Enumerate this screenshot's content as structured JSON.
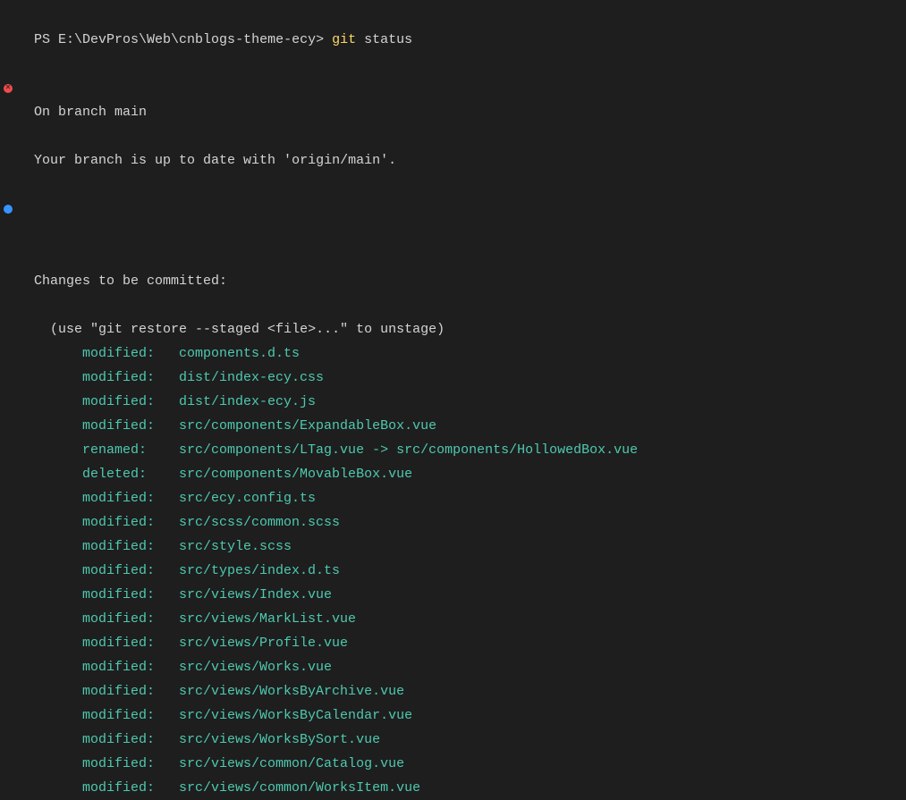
{
  "prompt": {
    "prefix": "PS ",
    "path": "E:\\DevPros\\Web\\cnblogs-theme-ecy",
    "suffix": "> ",
    "command": "git",
    "args": " status"
  },
  "branch_info": {
    "line1": "On branch main",
    "line2": "Your branch is up to date with 'origin/main'."
  },
  "section": {
    "title": "Changes to be committed:",
    "hint": "  (use \"git restore --staged <file>...\" to unstage)"
  },
  "files": [
    {
      "status": "modified:",
      "path": "components.d.ts"
    },
    {
      "status": "modified:",
      "path": "dist/index-ecy.css"
    },
    {
      "status": "modified:",
      "path": "dist/index-ecy.js"
    },
    {
      "status": "modified:",
      "path": "src/components/ExpandableBox.vue"
    },
    {
      "status": "renamed: ",
      "path": "src/components/LTag.vue -> src/components/HollowedBox.vue"
    },
    {
      "status": "deleted: ",
      "path": "src/components/MovableBox.vue"
    },
    {
      "status": "modified:",
      "path": "src/ecy.config.ts"
    },
    {
      "status": "modified:",
      "path": "src/scss/common.scss"
    },
    {
      "status": "modified:",
      "path": "src/style.scss"
    },
    {
      "status": "modified:",
      "path": "src/types/index.d.ts"
    },
    {
      "status": "modified:",
      "path": "src/views/Index.vue"
    },
    {
      "status": "modified:",
      "path": "src/views/MarkList.vue"
    },
    {
      "status": "modified:",
      "path": "src/views/Profile.vue"
    },
    {
      "status": "modified:",
      "path": "src/views/Works.vue"
    },
    {
      "status": "modified:",
      "path": "src/views/WorksByArchive.vue"
    },
    {
      "status": "modified:",
      "path": "src/views/WorksByCalendar.vue"
    },
    {
      "status": "modified:",
      "path": "src/views/WorksBySort.vue"
    },
    {
      "status": "modified:",
      "path": "src/views/common/Catalog.vue"
    },
    {
      "status": "modified:",
      "path": "src/views/common/WorksItem.vue"
    }
  ]
}
